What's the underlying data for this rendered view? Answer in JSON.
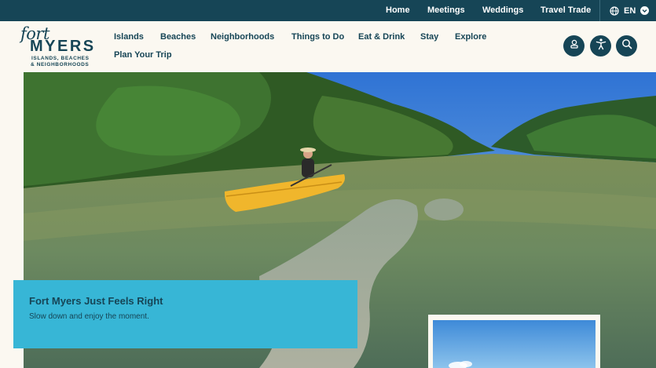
{
  "utility_nav": {
    "links": [
      "Home",
      "Meetings",
      "Weddings",
      "Travel Trade"
    ],
    "language": "EN"
  },
  "logo": {
    "line1": "fort",
    "line2": "MYERS",
    "line3": "ISLANDS, BEACHES",
    "line4": "& NEIGHBORHOODS"
  },
  "main_nav": {
    "items": [
      "Islands",
      "Beaches",
      "Neighborhoods",
      "Things to Do",
      "Eat & Drink",
      "Stay",
      "Explore",
      "Plan Your Trip"
    ]
  },
  "hero": {
    "title": "Fort Myers Just Feels Right",
    "subtitle": "Slow down and enjoy the moment."
  },
  "colors": {
    "brand_dark": "#164556",
    "accent": "#37b6d6",
    "background": "#fbf8f1"
  },
  "icons": [
    "globe-icon",
    "chevron-down-icon",
    "account-icon",
    "accessibility-icon",
    "search-icon"
  ]
}
